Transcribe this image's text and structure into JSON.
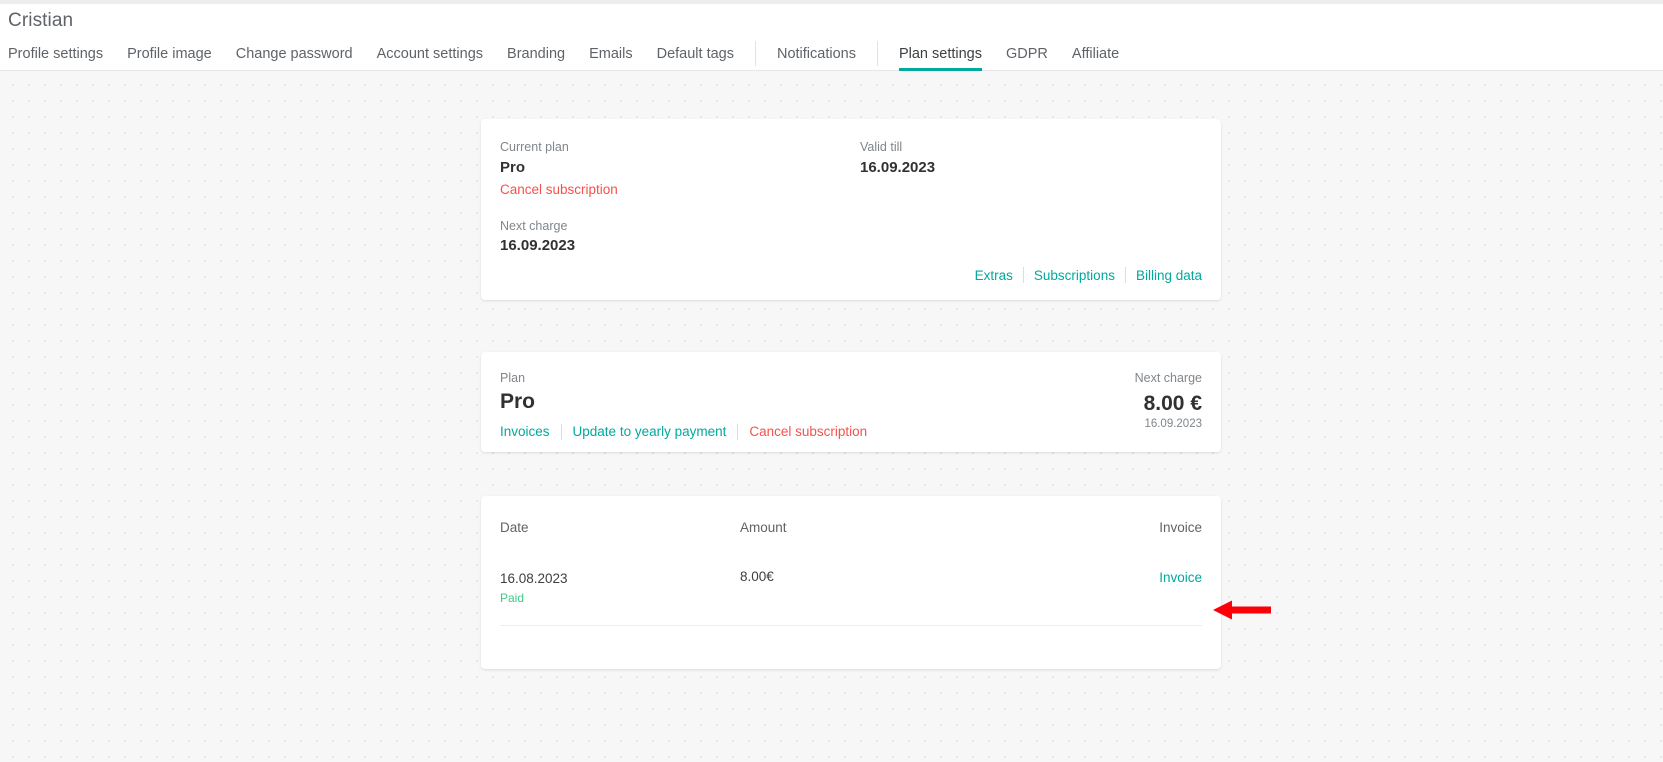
{
  "header": {
    "title": "Cristian"
  },
  "tabs": [
    {
      "label": "Profile settings",
      "active": false,
      "sep_after": false
    },
    {
      "label": "Profile image",
      "active": false,
      "sep_after": false
    },
    {
      "label": "Change password",
      "active": false,
      "sep_after": false
    },
    {
      "label": "Account settings",
      "active": false,
      "sep_after": false
    },
    {
      "label": "Branding",
      "active": false,
      "sep_after": false
    },
    {
      "label": "Emails",
      "active": false,
      "sep_after": false
    },
    {
      "label": "Default tags",
      "active": false,
      "sep_after": true
    },
    {
      "label": "Notifications",
      "active": false,
      "sep_after": true
    },
    {
      "label": "Plan settings",
      "active": true,
      "sep_after": false
    },
    {
      "label": "GDPR",
      "active": false,
      "sep_after": false
    },
    {
      "label": "Affiliate",
      "active": false,
      "sep_after": false
    }
  ],
  "plan_card": {
    "current_plan_label": "Current plan",
    "current_plan_value": "Pro",
    "cancel_link": "Cancel subscription",
    "next_charge_label": "Next charge",
    "next_charge_value": "16.09.2023",
    "valid_till_label": "Valid till",
    "valid_till_value": "16.09.2023",
    "footer_links": [
      {
        "label": "Extras"
      },
      {
        "label": "Subscriptions"
      },
      {
        "label": "Billing data"
      }
    ]
  },
  "subscription_card": {
    "plan_label": "Plan",
    "plan_value": "Pro",
    "links": [
      {
        "label": "Invoices",
        "style": "teal"
      },
      {
        "label": "Update to yearly payment",
        "style": "teal"
      },
      {
        "label": "Cancel subscription",
        "style": "danger"
      }
    ],
    "next_charge_label": "Next charge",
    "next_charge_amount": "8.00 €",
    "next_charge_date": "16.09.2023"
  },
  "invoice_card": {
    "columns": {
      "date": "Date",
      "amount": "Amount",
      "invoice": "Invoice"
    },
    "rows": [
      {
        "date": "16.08.2023",
        "status": "Paid",
        "amount": "8.00€",
        "invoice_link": "Invoice"
      }
    ]
  },
  "annotation": {
    "arrow_icon": "left-arrow-icon",
    "color": "#fb0007"
  },
  "colors": {
    "accent_teal": "#00a99d",
    "danger_red": "#f4524d",
    "status_green": "#3fc985",
    "page_background": "#f7f7f8",
    "card_background": "#ffffff",
    "text_primary": "#3c4043",
    "text_muted": "#80868b"
  }
}
